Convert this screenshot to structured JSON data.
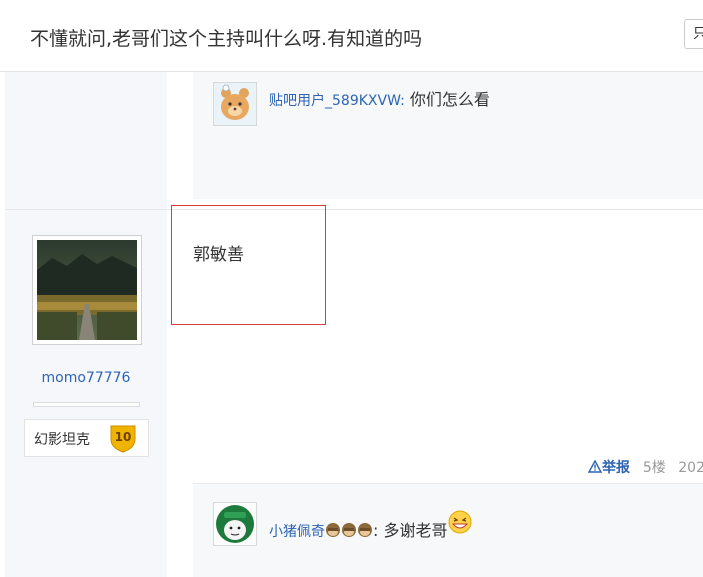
{
  "header": {
    "title": "不懂就问,老哥们这个主持叫什么呀.有知道的吗",
    "only_label": "只"
  },
  "prev_comment": {
    "user": "贴吧用户_589KXVW:",
    "text": "你们怎么看"
  },
  "post": {
    "author": "momo77776",
    "badge_name": "幻影坦克",
    "badge_level": "10",
    "content": "郭敏善",
    "report_label": "举报",
    "floor": "5楼",
    "date": "202"
  },
  "reply_comment": {
    "user": "小猪佩奇",
    "emoji_count": 3,
    "text": ": 多谢老哥"
  },
  "icons": {
    "report": "warning-triangle-icon",
    "emoji": "monkey-face-icon",
    "smile": "grin-face-icon"
  },
  "colors": {
    "link": "#2d64b3",
    "highlight": "#d63c3c",
    "badge_gold": "#f0b400"
  }
}
